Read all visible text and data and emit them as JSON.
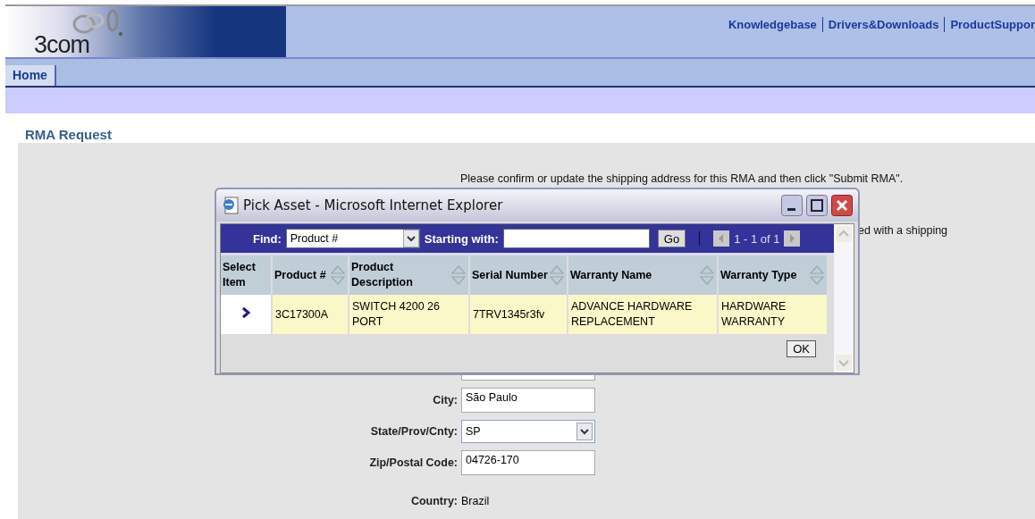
{
  "header": {
    "logo": "3com",
    "links": [
      "Knowledgebase",
      "Drivers&Downloads",
      "ProductSuppor"
    ]
  },
  "tabs": [
    {
      "label": "Home",
      "selected": true
    }
  ],
  "page_title": "RMA Request",
  "instructions": [
    "Please confirm or update the shipping address for this RMA and then click \"Submit RMA\".",
    "ed with a shipping"
  ],
  "form": [
    {
      "kind": "text"
    },
    {
      "label": "City:",
      "kind": "text",
      "value": "São Paulo"
    },
    {
      "label": "State/Prov/Cnty:",
      "kind": "select",
      "value": "SP"
    },
    {
      "label": "Zip/Postal Code:",
      "kind": "text",
      "value": "04726-170"
    },
    {
      "label": "Country:",
      "kind": "static",
      "value": "Brazil"
    }
  ],
  "dialog": {
    "title": "Pick Asset - Microsoft Internet Explorer",
    "find_label": "Find:",
    "find_value": "Product #",
    "starting_label": "Starting with:",
    "go": "Go",
    "pager": "1 - 1 of 1",
    "columns": [
      {
        "label": "Select Item",
        "sortable": false
      },
      {
        "label": "Product #",
        "sortable": true
      },
      {
        "label": "Product Description",
        "sortable": true
      },
      {
        "label": "Serial Number",
        "sortable": true
      },
      {
        "label": "Warranty Name",
        "sortable": true
      },
      {
        "label": "Warranty Type",
        "sortable": true
      }
    ],
    "rows": [
      {
        "cells": [
          "",
          "3C17300A",
          "SWITCH 4200 26 PORT",
          "7TRV1345r3fv",
          "ADVANCE HARDWARE REPLACEMENT",
          "HARDWARE WARRANTY"
        ]
      }
    ],
    "ok": "OK"
  }
}
